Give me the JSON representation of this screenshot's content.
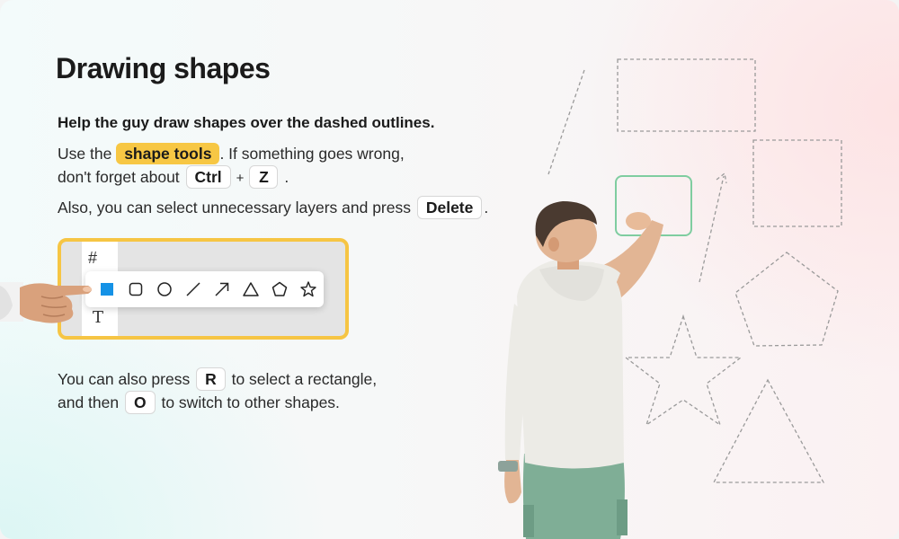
{
  "title": "Drawing shapes",
  "lead": "Help the guy draw shapes over the dashed outlines.",
  "para1": {
    "before": "Use the ",
    "highlight": "shape tools",
    "after": ". If something goes wrong,",
    "line2": "don't forget about ",
    "key1": "Ctrl",
    "plus": "+",
    "key2": "Z",
    "end": "."
  },
  "para2": {
    "text": "Also, you can select unnecessary layers and press ",
    "key": "Delete",
    "end": "."
  },
  "para3": {
    "line1_before": "You can also press ",
    "key1": "R",
    "line1_after": " to select a rectangle,",
    "line2_before": "and then ",
    "key2": "O",
    "line2_after": " to switch to other shapes."
  },
  "toolbar": {
    "tools": [
      "rectangle-tool",
      "rounded-rectangle-tool",
      "ellipse-tool",
      "line-tool",
      "arrow-tool",
      "triangle-tool",
      "pentagon-tool",
      "star-tool"
    ],
    "active": "rectangle-tool",
    "active_color": "#1592e6",
    "frame_tool_icon": "#",
    "text_tool_icon": "T"
  },
  "colors": {
    "highlight": "#f7c744",
    "frame_border": "#f6c544",
    "drawn_rect": "#7fcda0",
    "dashed": "#9a9a9a"
  }
}
